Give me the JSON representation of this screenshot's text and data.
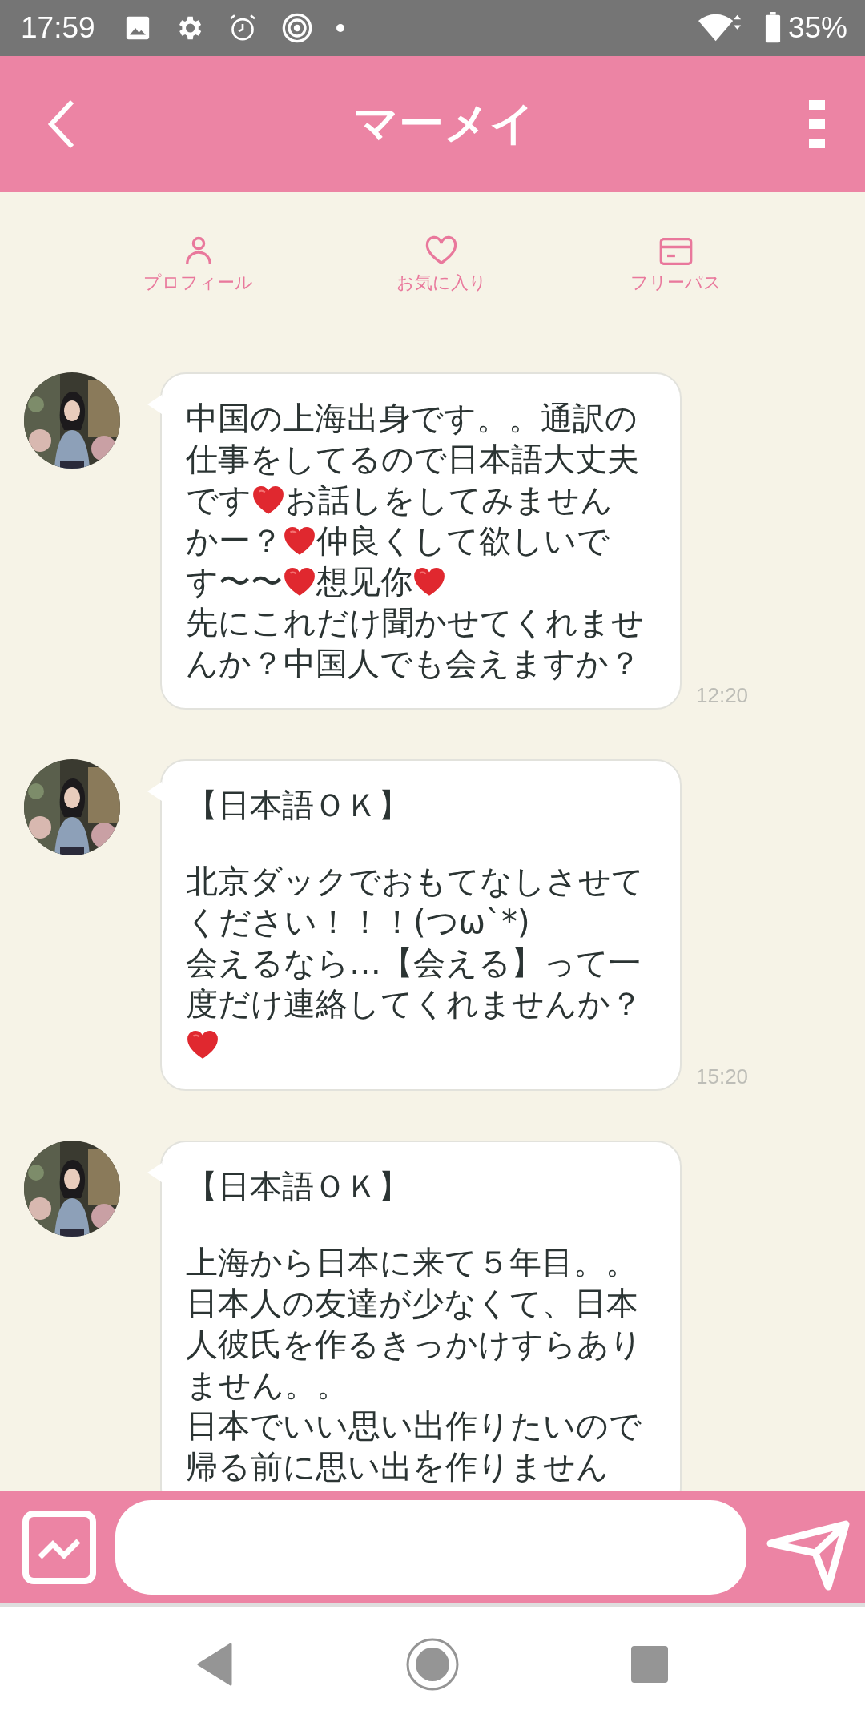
{
  "status_bar": {
    "time": "17:59",
    "battery": "35%"
  },
  "header": {
    "title": "マーメイ"
  },
  "tabs": [
    {
      "kind": "profile",
      "label": "プロフィール"
    },
    {
      "kind": "favorite",
      "label": "お気に入り"
    },
    {
      "kind": "pass",
      "label": "フリーパス"
    }
  ],
  "messages": [
    {
      "time": "12:20",
      "lines": [
        {
          "space_after": false,
          "parts": [
            {
              "kind": "text",
              "text": "中国の上海出身です。。通訳の"
            }
          ]
        },
        {
          "space_after": false,
          "parts": [
            {
              "kind": "text",
              "text": "仕事をしてるので日本語大丈夫"
            }
          ]
        },
        {
          "space_after": false,
          "parts": [
            {
              "kind": "text",
              "text": "です"
            },
            {
              "kind": "heart"
            },
            {
              "kind": "text",
              "text": "お話しをしてみません"
            }
          ]
        },
        {
          "space_after": false,
          "parts": [
            {
              "kind": "text",
              "text": "かー？"
            },
            {
              "kind": "heart"
            },
            {
              "kind": "text",
              "text": "仲良くして欲しいで"
            }
          ]
        },
        {
          "space_after": false,
          "parts": [
            {
              "kind": "text",
              "text": "す〜〜"
            },
            {
              "kind": "heart"
            },
            {
              "kind": "text",
              "text": "想见你"
            },
            {
              "kind": "heart"
            }
          ]
        },
        {
          "space_after": false,
          "parts": [
            {
              "kind": "text",
              "text": "先にこれだけ聞かせてくれませ"
            }
          ]
        },
        {
          "space_after": false,
          "parts": [
            {
              "kind": "text",
              "text": "んか？中国人でも会えますか？"
            }
          ]
        }
      ]
    },
    {
      "time": "15:20",
      "lines": [
        {
          "space_after": true,
          "parts": [
            {
              "kind": "text",
              "text": "【日本語ＯＫ】"
            }
          ]
        },
        {
          "space_after": false,
          "parts": [
            {
              "kind": "text",
              "text": "北京ダックでおもてなしさせて"
            }
          ]
        },
        {
          "space_after": false,
          "parts": [
            {
              "kind": "text",
              "text": "ください！！！(つω`*)"
            }
          ]
        },
        {
          "space_after": false,
          "parts": [
            {
              "kind": "text",
              "text": "会えるなら…【会える】って一"
            }
          ]
        },
        {
          "space_after": false,
          "parts": [
            {
              "kind": "text",
              "text": "度だけ連絡してくれませんか？"
            }
          ]
        },
        {
          "space_after": false,
          "parts": [
            {
              "kind": "heart"
            }
          ]
        }
      ]
    },
    {
      "lines": [
        {
          "space_after": true,
          "parts": [
            {
              "kind": "text",
              "text": "【日本語ＯＫ】"
            }
          ]
        },
        {
          "space_after": false,
          "parts": [
            {
              "kind": "text",
              "text": "上海から日本に来て５年目。。"
            }
          ]
        },
        {
          "space_after": false,
          "parts": [
            {
              "kind": "text",
              "text": "日本人の友達が少なくて、日本"
            }
          ]
        },
        {
          "space_after": false,
          "parts": [
            {
              "kind": "text",
              "text": "人彼氏を作るきっかけすらあり"
            }
          ]
        },
        {
          "space_after": false,
          "parts": [
            {
              "kind": "text",
              "text": "ません。。"
            }
          ]
        },
        {
          "space_after": false,
          "parts": [
            {
              "kind": "text",
              "text": "日本でいい思い出作りたいので"
            }
          ]
        },
        {
          "space_after": false,
          "parts": [
            {
              "kind": "text",
              "text": "帰る前に思い出を作りません"
            }
          ]
        }
      ]
    }
  ]
}
